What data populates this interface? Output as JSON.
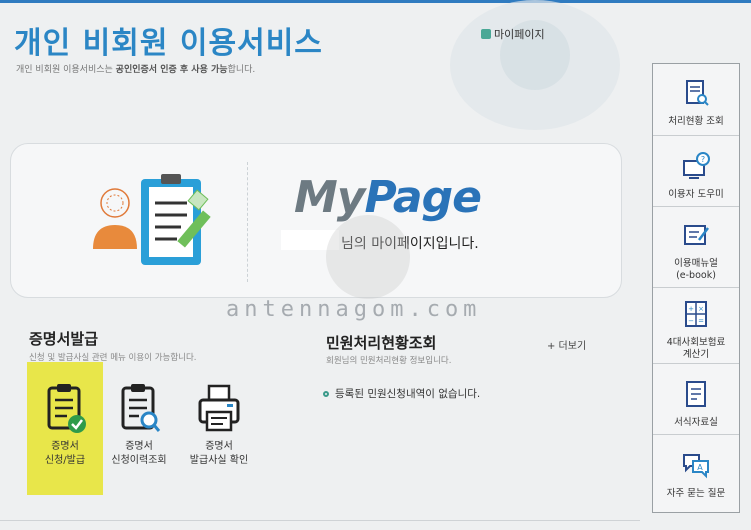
{
  "header": {
    "title": "개인 비회원 이용서비스",
    "subtitle_prefix": "개인 비회원 이용서비스는 ",
    "subtitle_bold": "공인인증서 인증 후 사용 가능",
    "subtitle_suffix": "합니다.",
    "mypage_link": "마이페이지"
  },
  "banner": {
    "logo_my": "My",
    "logo_page": "Page",
    "welcome_text": "님의 마이페이지입니다."
  },
  "watermark": "antennagom.com",
  "certificate_section": {
    "title": "증명서발급",
    "description": "신청 및 발급사실 관련 메뉴 이용이 가능합니다.",
    "items": [
      {
        "line1": "증명서",
        "line2": "신청/발급",
        "icon": "clipboard-check-icon"
      },
      {
        "line1": "증명서",
        "line2": "신청이력조회",
        "icon": "clipboard-search-icon"
      },
      {
        "line1": "증명서",
        "line2": "발급사실 확인",
        "icon": "printer-icon"
      }
    ]
  },
  "status_section": {
    "title": "민원처리현황조회",
    "description": "회원님의 민원처리현황 정보입니다.",
    "more_link": "+ 더보기",
    "empty_message": "등록된 민원신청내역이 없습니다."
  },
  "right_panel": {
    "items": [
      {
        "label": "처리현황 조회",
        "icon": "document-search-icon"
      },
      {
        "label": "이용자 도우미",
        "icon": "help-monitor-icon"
      },
      {
        "label": "이용매뉴얼",
        "label2": "(e-book)",
        "icon": "manual-edit-icon"
      },
      {
        "label": "4대사회보험료",
        "label2": "계산기",
        "icon": "calculator-icon"
      },
      {
        "label": "서식자료실",
        "icon": "form-document-icon"
      },
      {
        "label": "자주 묻는 질문",
        "icon": "faq-chat-icon"
      }
    ]
  },
  "colors": {
    "accent_blue": "#2b86c5",
    "highlight_yellow": "#e8e64a",
    "check_green": "#2e9b4a"
  }
}
